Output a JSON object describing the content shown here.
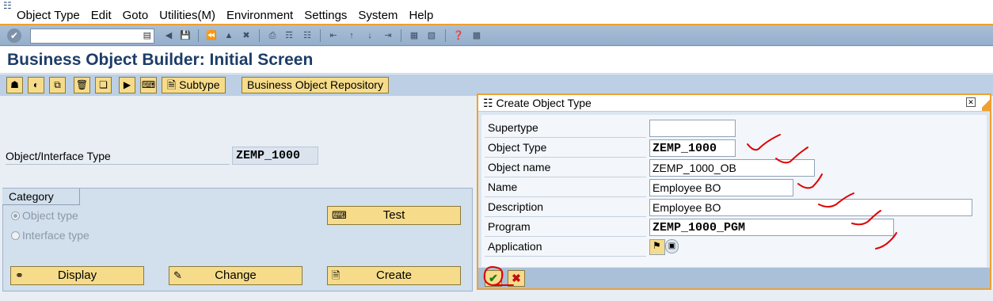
{
  "menubar": {
    "items": [
      "Object Type",
      "Edit",
      "Goto",
      "Utilities(M)",
      "Environment",
      "Settings",
      "System",
      "Help"
    ]
  },
  "stdtoolbar": {
    "command_value": ""
  },
  "page": {
    "title": "Business Object Builder: Initial Screen"
  },
  "apptoolbar": {
    "subtype_label": "Subtype",
    "repository_label": "Business Object Repository"
  },
  "main": {
    "object_label": "Object/Interface Type",
    "object_value": "ZEMP_1000",
    "category": {
      "title": "Category",
      "radio_object": "Object type",
      "radio_interface": "Interface type",
      "selected": "Object type"
    },
    "buttons": {
      "test": "Test",
      "display": "Display",
      "change": "Change",
      "create": "Create"
    }
  },
  "dialog": {
    "title": "Create Object Type",
    "fields": {
      "supertype_label": "Supertype",
      "supertype_value": "",
      "object_type_label": "Object Type",
      "object_type_value": "ZEMP_1000",
      "object_name_label": "Object name",
      "object_name_value": "ZEMP_1000_OB",
      "name_label": "Name",
      "name_value": "Employee BO",
      "description_label": "Description",
      "description_value": "Employee BO",
      "program_label": "Program",
      "program_value": "ZEMP_1000_PGM",
      "application_label": "Application",
      "application_value": ""
    }
  },
  "colors": {
    "accent": "#f0a030",
    "title_text": "#1d3d68",
    "button_fill": "#f6dc8a",
    "annotation_red": "#e00000"
  }
}
